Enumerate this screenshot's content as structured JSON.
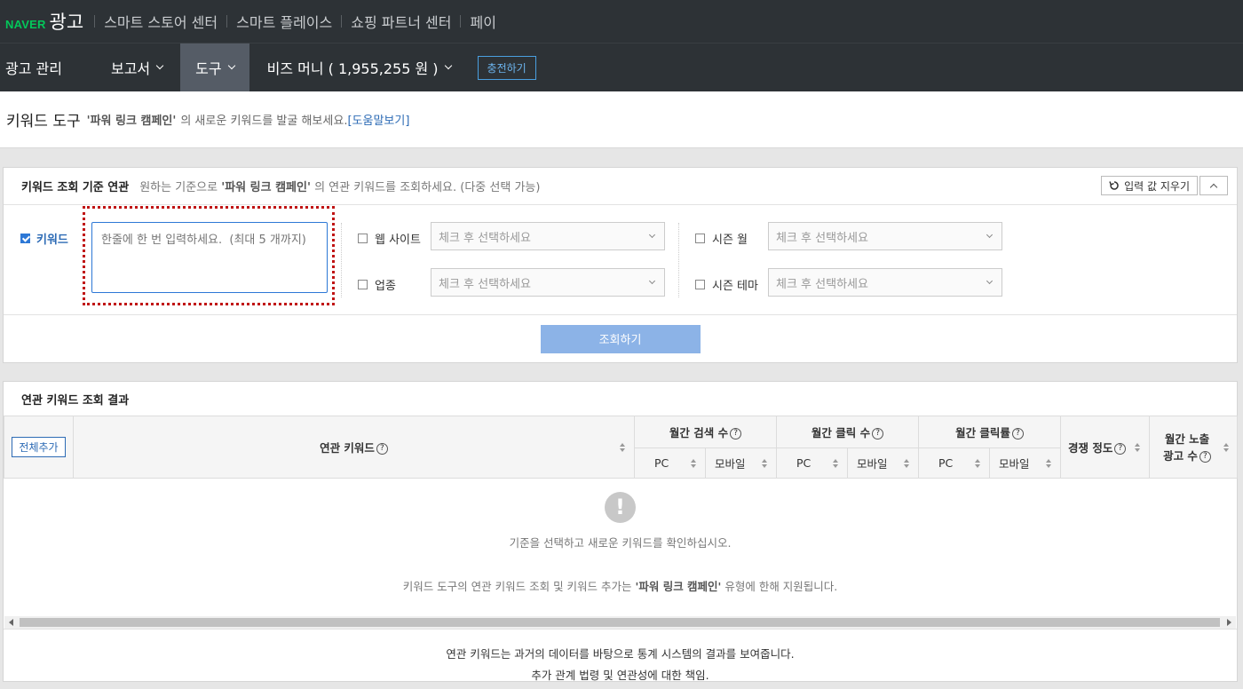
{
  "topnav": {
    "logo_naver": "NAVER",
    "logo_ad": "광고",
    "links": [
      "스마트 스토어 센터",
      "스마트 플레이스",
      "쇼핑 파트너 센터",
      "페이"
    ]
  },
  "subnav": {
    "ad_manage": "광고 관리",
    "report": "보고서",
    "tools": "도구",
    "bizmoney": "비즈 머니 ( 1,955,255 원 )",
    "charge": "충전하기"
  },
  "pagehead": {
    "title": "키워드 도구",
    "campaign": "'파워 링크 캠페인'",
    "desc": "의 새로운 키워드를 발굴 해보세요.",
    "help": "[도움말보기]"
  },
  "criteria": {
    "title": "키워드 조회 기준 연관",
    "desc_prefix": "원하는 기준으로",
    "desc_campaign": "'파워 링크 캠페인'",
    "desc_suffix": "의 연관 키워드를 조회하세요. (다중 선택 가능)",
    "reset": "입력 값 지우기",
    "keyword_label": "키워드",
    "keyword_placeholder": "한줄에 한 번 입력하세요.  (최대 5 개까지)",
    "website_label": "웹 사이트",
    "industry_label": "업종",
    "season_month_label": "시즌 월",
    "season_theme_label": "시즌 테마",
    "select_placeholder": "체크 후 선택하세요",
    "search_button": "조회하기"
  },
  "results": {
    "title": "연관 키워드 조회 결과",
    "add_all": "전체추가",
    "col_keyword": "연관 키워드",
    "col_search": "월간 검색 수",
    "col_click": "월간 클릭 수",
    "col_ctr": "월간 클릭률",
    "col_competition": "경쟁 정도",
    "col_ads_line1": "월간 노출",
    "col_ads_line2": "광고 수",
    "pc": "PC",
    "mobile": "모바일",
    "qmark": "?",
    "empty_icon": "!",
    "empty_msg": "기준을 선택하고 새로운 키워드를 확인하십시오.",
    "note_prefix": "키워드 도구의 연관 키워드 조회 및 키워드 추가는",
    "note_campaign": "'파워 링크 캠페인'",
    "note_suffix": "유형에 한해 지원됩니다.",
    "footnote1": "연관 키워드는 과거의 데이터를 바탕으로 통계 시스템의 결과를 보여줍니다.",
    "footnote2": "추가 관계 법령 및 연관성에 대한 책임."
  }
}
